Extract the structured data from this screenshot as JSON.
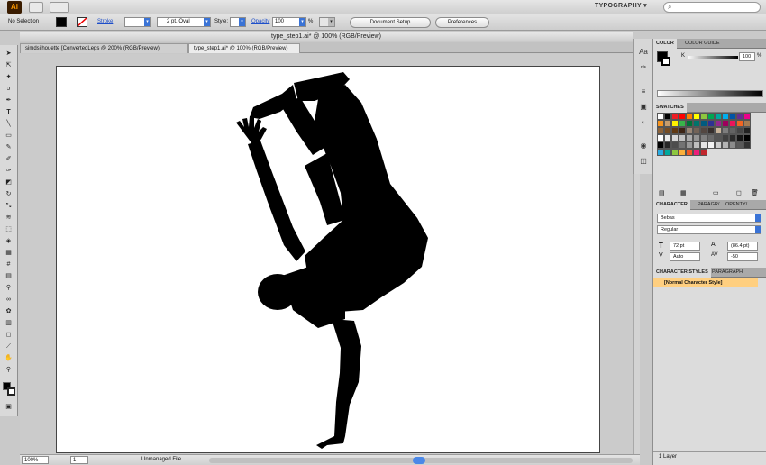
{
  "app": {
    "logo": "Ai",
    "workspace": "TYPOGRAPHY ▾",
    "help_search_icon": "search-icon"
  },
  "controlbar": {
    "selection": "No Selection",
    "stroke_label": "Stroke",
    "brush_value": "2 pt. Oval",
    "style_label": "Style:",
    "opacity_label": "Opacity",
    "opacity_value": "100",
    "percent": "%",
    "document_setup": "Document Setup",
    "preferences": "Preferences"
  },
  "document": {
    "title": "type_step1.ai* @ 100% (RGB/Preview)",
    "tabs": [
      {
        "label": "simdsilhouette [ConvertedLeps @ 200% (RGB/Preview)"
      },
      {
        "label": "type_step1.ai* @ 100% (RGB/Preview)"
      }
    ]
  },
  "statusbar": {
    "zoom": "100%",
    "page": "1",
    "file_status": "Unmanaged File"
  },
  "panels": {
    "color": {
      "tabs": [
        "COLOR",
        "COLOR GUIDE"
      ],
      "k_label": "K",
      "k_value": "100",
      "percent": "%"
    },
    "swatches": {
      "title": "SWATCHES",
      "colors": [
        "#ffffff",
        "#000000",
        "#ed1c24",
        "#ff0000",
        "#ff8000",
        "#ffff00",
        "#8dc63f",
        "#00a651",
        "#00a99d",
        "#00aeef",
        "#0054a6",
        "#662d91",
        "#ec008c",
        "#f7941d",
        "#c69c6d",
        "#fff200",
        "#39b54a",
        "#007236",
        "#00746b",
        "#005b7f",
        "#2e3192",
        "#92278f",
        "#9e005d",
        "#ed145b",
        "#f26522",
        "#a67c52",
        "#8c6239",
        "#754c24",
        "#603913",
        "#3c2415",
        "#998675",
        "#736357",
        "#534741",
        "#362f2d",
        "#c7b299",
        "#7d7d7d",
        "#636363",
        "#464646",
        "#222222",
        "#ffffff",
        "#ebebeb",
        "#d7d7d7",
        "#c2c2c2",
        "#acacac",
        "#959595",
        "#808080",
        "#6a6a6a",
        "#555555",
        "#404040",
        "#2b2b2b",
        "#151515",
        "#000000",
        "#000000",
        "#262626",
        "#4d4d4d",
        "#737373",
        "#999999",
        "#bfbfbf",
        "#e6e6e6",
        "#f2f2f2",
        "#cccccc",
        "#b3b3b3",
        "#8c8c8c",
        "#595959",
        "#333333",
        "#29abe2",
        "#00a99d",
        "#8cc63f",
        "#fbb03b",
        "#f15a24",
        "#ed1e79",
        "#c1272d"
      ]
    },
    "character": {
      "tabs": [
        "CHARACTER",
        "PARAGR/",
        "OPENTY/"
      ],
      "font": "Bebas",
      "style": "Regular",
      "size": "72 pt",
      "leading": "(86.4 pt)",
      "kerning": "Auto",
      "tracking": "-50"
    },
    "character_styles": {
      "tabs": [
        "CHARACTER STYLES",
        "PARAGRAPH"
      ],
      "item": "[Normal Character Style]"
    },
    "layers": {
      "count": "1 Layer"
    }
  }
}
